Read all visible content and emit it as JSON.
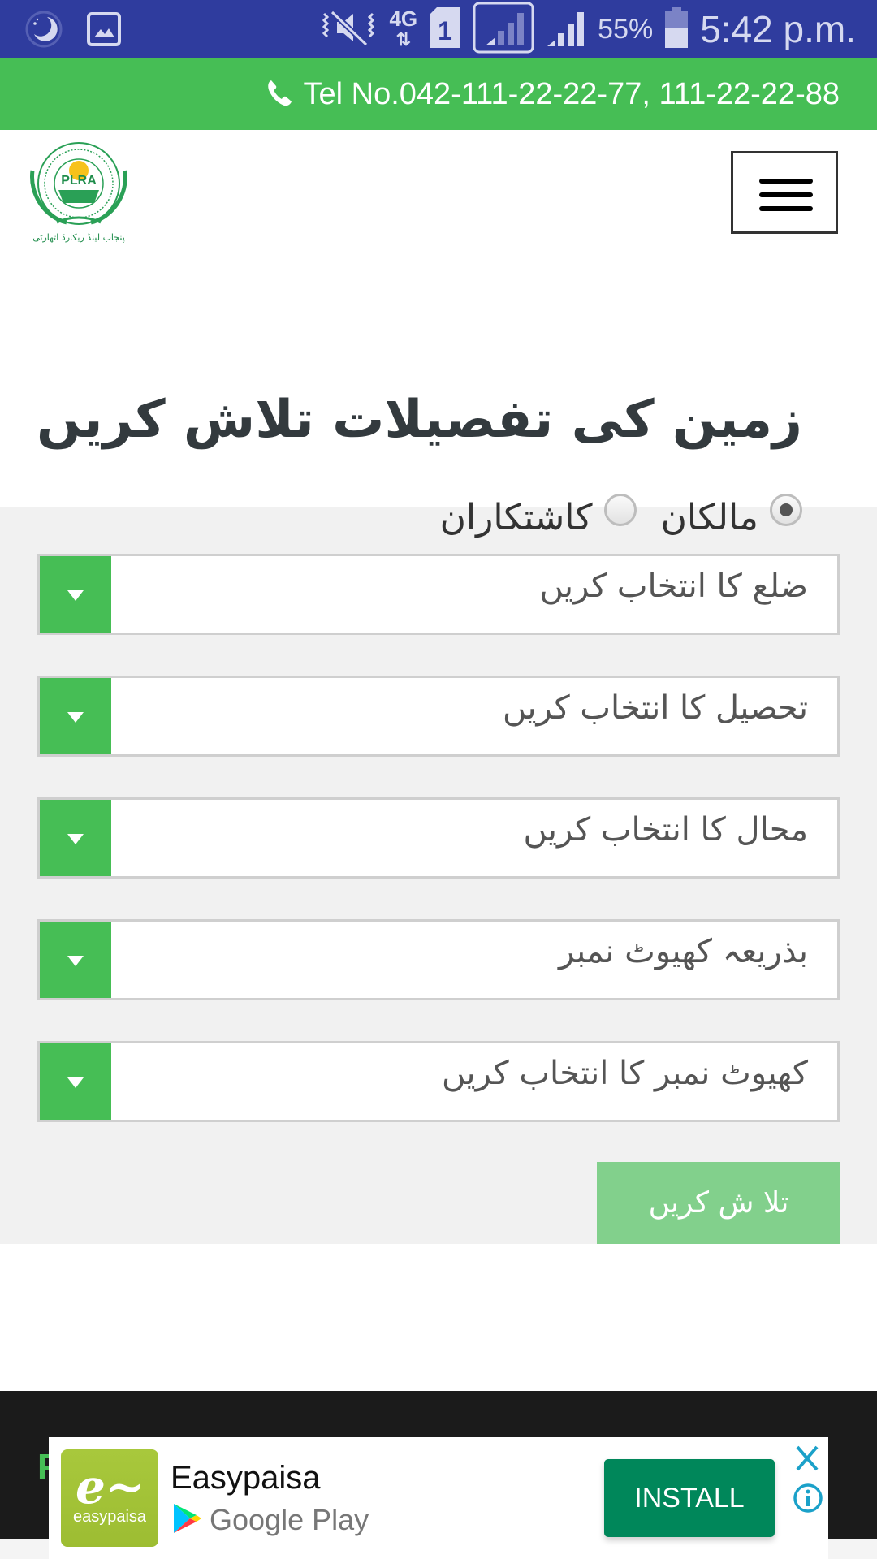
{
  "status_bar": {
    "icons_left": [
      "night-mode-icon",
      "gallery-icon"
    ],
    "icons_right": [
      "vibrate-off-icon",
      "network-4g-icon",
      "sim-1-icon",
      "signal-sim1-icon",
      "signal-sim2-icon",
      "battery-icon"
    ],
    "network_type": "4G",
    "sim_label": "1",
    "battery_percent": "55%",
    "battery_level": 0.55,
    "time": "5:42 p.m."
  },
  "tel_bar": {
    "icon": "phone-icon",
    "text": "Tel No.042-111-22-22-77, 111-22-22-88"
  },
  "header": {
    "logo_text": "PLRA",
    "logo_caption": "پنجاب لینڈ ریکارڈ اتھارٹی",
    "menu_icon": "hamburger-menu-icon"
  },
  "page_title": "زمین کی تفصیلات تلاش کریں",
  "colors": {
    "status_bar": "#2f3c9e",
    "brand_green": "#46be55",
    "button_disabled_green": "#82d08c",
    "footer_dark": "#1b1b1b",
    "install_green": "#00875a",
    "ad_accent": "#1ba1c9"
  },
  "form": {
    "owner_type": {
      "options": [
        {
          "label": "مالکان",
          "checked": true
        },
        {
          "label": "کاشتکاران",
          "checked": false
        }
      ]
    },
    "selects": [
      {
        "name": "district",
        "value": "ضلع کا انتخاب کریں"
      },
      {
        "name": "tehsil",
        "value": "تحصیل کا انتخاب کریں"
      },
      {
        "name": "mauza",
        "value": "محال کا انتخاب کریں"
      },
      {
        "name": "search-by",
        "value": "بذریعہ کھیوٹ نمبر"
      },
      {
        "name": "khewat",
        "value": "کھیوٹ نمبر کا انتخاب کریں"
      }
    ],
    "search_button": "تلا ش کریں"
  },
  "footer": {
    "partial_heading_letter": "P"
  },
  "ad": {
    "app_name": "Easypaisa",
    "logo_text": "easypaisa",
    "store": "Google Play",
    "install_label": "INSTALL"
  }
}
